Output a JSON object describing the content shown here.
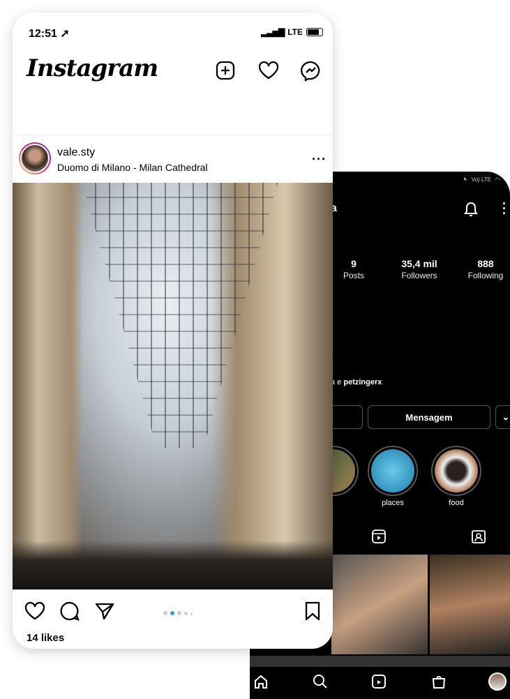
{
  "feed": {
    "status": {
      "time": "12:51",
      "network": "LTE"
    },
    "logo": "Instagram",
    "header_icons": [
      "plus-square-icon",
      "heart-icon",
      "messenger-icon"
    ],
    "post": {
      "username": "vale.sty",
      "location": "Duomo di Milano - Milan Cathedral",
      "likes": "14 likes",
      "carousel_total": 5,
      "carousel_active": 2
    }
  },
  "profile": {
    "status_icons": [
      "mute-icon",
      "volte-lte-icon",
      "wifi-icon"
    ],
    "status_text": "Vo) LTE",
    "name_fragment": "a",
    "stats": [
      {
        "value": "9",
        "label": "Posts"
      },
      {
        "value": "35,4 mil",
        "label": "Followers"
      },
      {
        "value": "888",
        "label": "Following"
      }
    ],
    "followed_by_prefix": "a e ",
    "followed_by_user": "petzingerx",
    "message_button": "Mensagem",
    "highlights": [
      {
        "label": ""
      },
      {
        "label": "places"
      },
      {
        "label": "food"
      }
    ],
    "colors": {
      "background": "#000000",
      "accent": "#3897f0"
    }
  }
}
